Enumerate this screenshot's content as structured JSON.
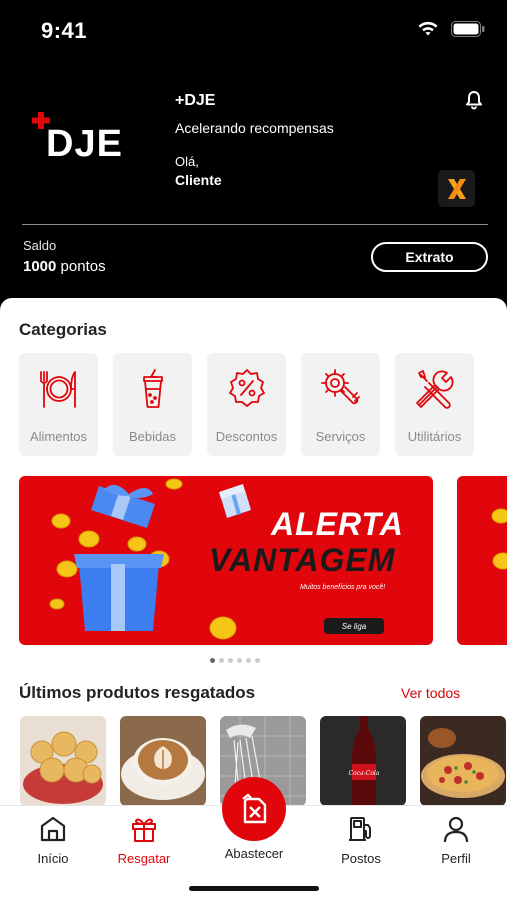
{
  "status_bar": {
    "time": "9:41"
  },
  "header": {
    "logo_text": "DJE",
    "brand_title": "+DJE",
    "brand_subtitle": "Acelerando recompensas",
    "greeting": "Olá,",
    "user_name": "Cliente",
    "badge_letter": "X",
    "balance_label": "Saldo",
    "balance_value": "1000",
    "balance_unit": "pontos",
    "statement_button": "Extrato"
  },
  "categories": {
    "title": "Categorias",
    "items": [
      {
        "label": "Alimentos",
        "icon": "utensils-icon"
      },
      {
        "label": "Bebidas",
        "icon": "drink-cup-icon"
      },
      {
        "label": "Descontos",
        "icon": "discount-badge-icon"
      },
      {
        "label": "Serviços",
        "icon": "wrench-gear-icon"
      },
      {
        "label": "Utilitários",
        "icon": "tools-icon"
      }
    ]
  },
  "banner": {
    "line1": "ALERTA",
    "line2": "VANTAGEM",
    "tagline": "Muitos benefícios pra você!",
    "cta": "Se liga"
  },
  "carousel": {
    "count": 6,
    "active_index": 0
  },
  "recent": {
    "title": "Últimos produtos resgatados",
    "see_all": "Ver todos",
    "items": [
      "cheese-bread",
      "cappuccino",
      "shower",
      "cola-bottle",
      "pizza"
    ]
  },
  "tabbar": {
    "items": [
      {
        "label": "Início",
        "icon": "home-icon"
      },
      {
        "label": "Resgatar",
        "icon": "gift-icon",
        "active": true
      },
      {
        "label": "Abastecer",
        "icon": "fuel-can-icon"
      },
      {
        "label": "Postos",
        "icon": "gas-station-icon"
      },
      {
        "label": "Perfil",
        "icon": "user-icon"
      }
    ]
  },
  "colors": {
    "accent": "#e0060b",
    "header_bg": "#000000",
    "card_bg": "#f2f2f2"
  }
}
